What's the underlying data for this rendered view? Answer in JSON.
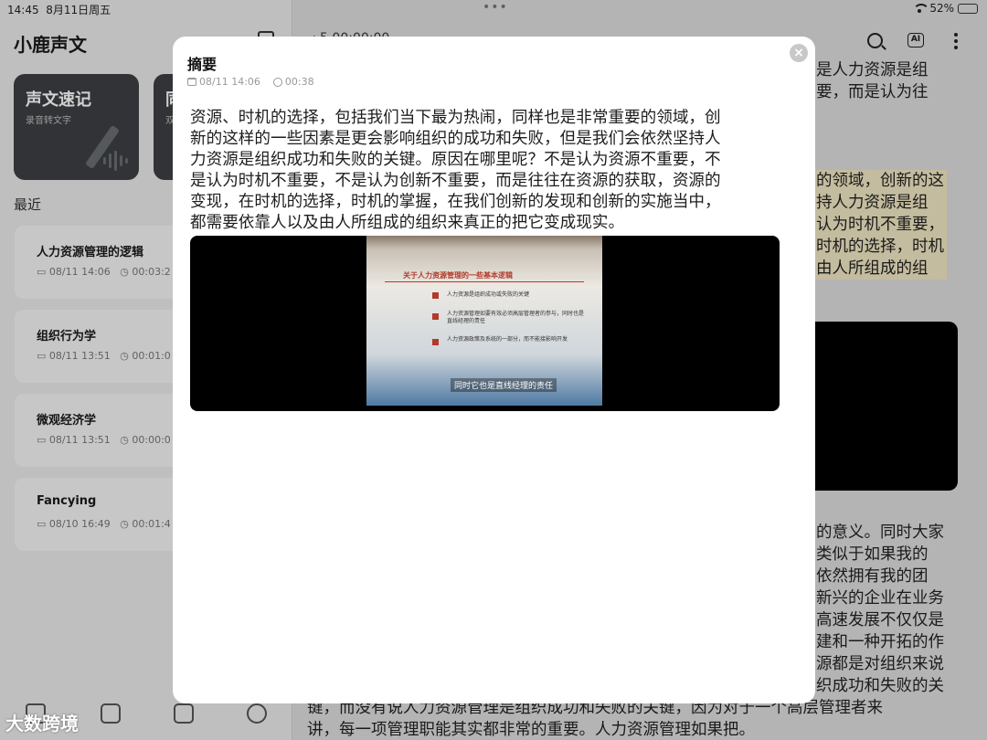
{
  "status_bar": {
    "time": "14:45",
    "date": "8月11日周五",
    "battery": "52%",
    "battery_level": 0.52
  },
  "sidebar": {
    "app_title": "小鹿声文",
    "feature_cards": [
      {
        "title": "声文速记",
        "subtitle": "录音转文字"
      },
      {
        "title": "同",
        "subtitle": "双"
      }
    ],
    "recent_label": "最近",
    "recent_items": [
      {
        "title": "人力资源管理的逻辑",
        "date": "08/11 14:06",
        "duration": "00:03:2"
      },
      {
        "title": "组织行为学",
        "date": "08/11 13:51",
        "duration": "00:01:0"
      },
      {
        "title": "微观经济学",
        "date": "08/11 13:51",
        "duration": "00:00:0"
      },
      {
        "title": "Fancying",
        "date": "08/10 16:49",
        "duration": "00:01:4"
      }
    ]
  },
  "main": {
    "header_partial": "‹   5    00:00:00",
    "ai_label": "AI",
    "bg_lines_top": [
      "是人力资源是组",
      "要，而是认为往"
    ],
    "bg_lines_mid": [
      "的领域，创新的这",
      "持人力资源是组",
      "认为时机不重要，",
      "时机的选择，时机",
      "由人所组成的组"
    ],
    "bg_lines_bottom": [
      "的意义。同时大家",
      "类似于如果我的",
      "依然拥有我的团",
      "新兴的企业在业务",
      "高速发展不仅仅是",
      "建和一种开拓的作",
      "源都是对组织来说",
      "织成功和失败的关"
    ],
    "bg_lines_full": [
      "键，而没有说人力资源管理是组织成功和失败的关键，因为对于一个高层管理者来",
      "讲，每一项管理职能其实都非常的重要。人力资源管理如果把。"
    ]
  },
  "modal": {
    "title": "摘要",
    "date": "08/11 14:06",
    "duration": "00:38",
    "close_label": "×",
    "summary_lines": [
      "资源、时机的选择，包括我们当下最为热闹，同样也是非常重要的领域，创",
      "新的这样的一些因素是更会影响组织的成功和失败，但是我们会依然坚持人",
      "力资源是组织成功和失败的关键。原因在哪里呢？不是认为资源不重要，不",
      "是认为时机不重要，不是认为创新不重要，而是往往在资源的获取，资源的",
      "变现，在时机的选择，时机的掌握，在我们创新的发现和创新的实施当中，",
      "都需要依靠人以及由人所组成的组织来真正的把它变成现实。"
    ],
    "video": {
      "slide_title": "关于人力资源管理的一些基本逻辑",
      "bullets": [
        "人力资源是组织成功或失败的关键",
        "人力资源管理如要有效必须高层管理者的参与，同时也是直线经理的责任",
        "人力资源政策及系统的一部分，而不能接影响开发"
      ],
      "subtitle": "同时它也是直线经理的责任"
    }
  },
  "watermark": "大数跨境"
}
